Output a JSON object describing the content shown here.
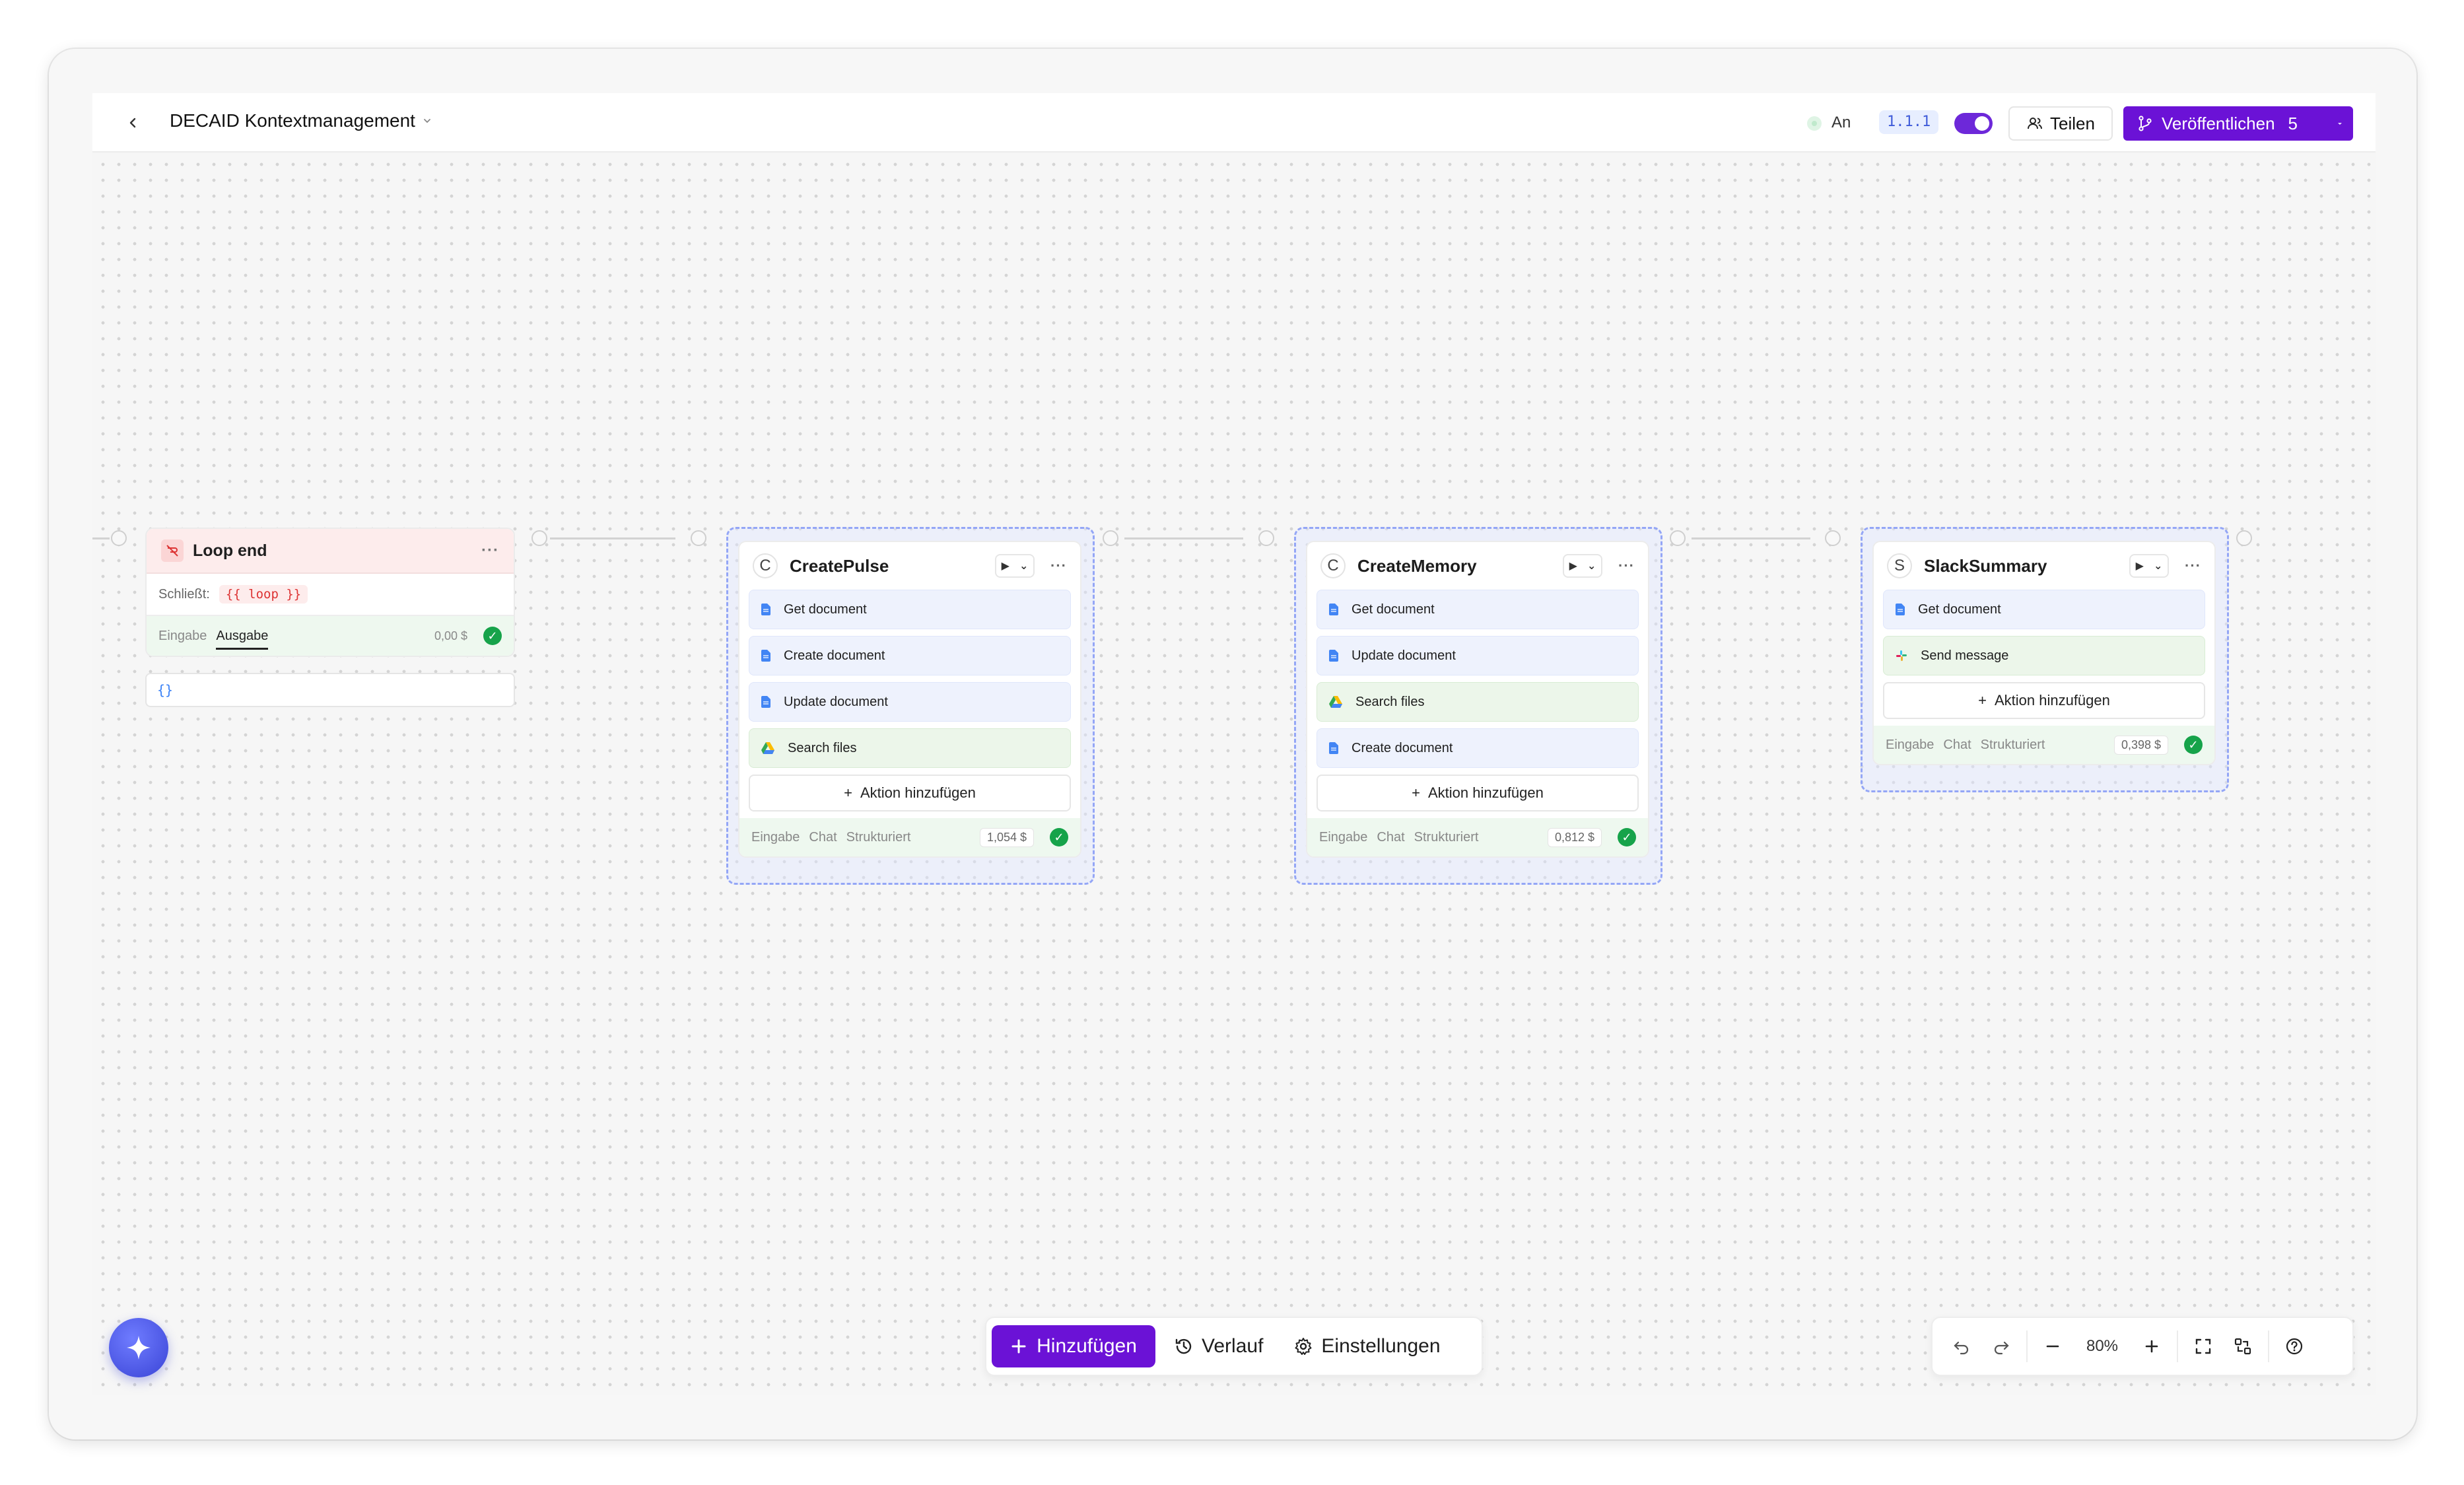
{
  "header": {
    "title": "DECAID Kontextmanagement",
    "status_label": "An",
    "version": "1.1.1",
    "share_label": "Teilen",
    "publish_label": "Veröffentlichen",
    "publish_count": "5"
  },
  "loop_node": {
    "title": "Loop end",
    "closes_label": "Schließt:",
    "closes_value": "{{ loop }}",
    "tab_input": "Eingabe",
    "tab_output": "Ausgabe",
    "price": "0,00 $",
    "output_value": "{}"
  },
  "nodes": [
    {
      "initial": "C",
      "title": "CreatePulse",
      "actions": [
        {
          "label": "Get document",
          "icon": "google-docs-icon"
        },
        {
          "label": "Create document",
          "icon": "google-docs-icon"
        },
        {
          "label": "Update document",
          "icon": "google-docs-icon"
        },
        {
          "label": "Search files",
          "icon": "google-drive-icon"
        }
      ],
      "add_action_label": "Aktion hinzufügen",
      "tabs": [
        "Eingabe",
        "Chat",
        "Strukturiert"
      ],
      "price": "1,054 $"
    },
    {
      "initial": "C",
      "title": "CreateMemory",
      "actions": [
        {
          "label": "Get document",
          "icon": "google-docs-icon"
        },
        {
          "label": "Update document",
          "icon": "google-docs-icon"
        },
        {
          "label": "Search files",
          "icon": "google-drive-icon"
        },
        {
          "label": "Create document",
          "icon": "google-docs-icon"
        }
      ],
      "add_action_label": "Aktion hinzufügen",
      "tabs": [
        "Eingabe",
        "Chat",
        "Strukturiert"
      ],
      "price": "0,812 $"
    },
    {
      "initial": "S",
      "title": "SlackSummary",
      "actions": [
        {
          "label": "Get document",
          "icon": "google-docs-icon"
        },
        {
          "label": "Send message",
          "icon": "slack-icon"
        }
      ],
      "add_action_label": "Aktion hinzufügen",
      "tabs": [
        "Eingabe",
        "Chat",
        "Strukturiert"
      ],
      "price": "0,398 $"
    }
  ],
  "toolbar": {
    "add_label": "Hinzufügen",
    "history_label": "Verlauf",
    "settings_label": "Einstellungen"
  },
  "zoom": {
    "level": "80%"
  },
  "colors": {
    "brand_purple": "#6b12d6",
    "group_border": "#94a6f6",
    "success_green": "#16a34a",
    "loop_header": "#fdecec"
  }
}
